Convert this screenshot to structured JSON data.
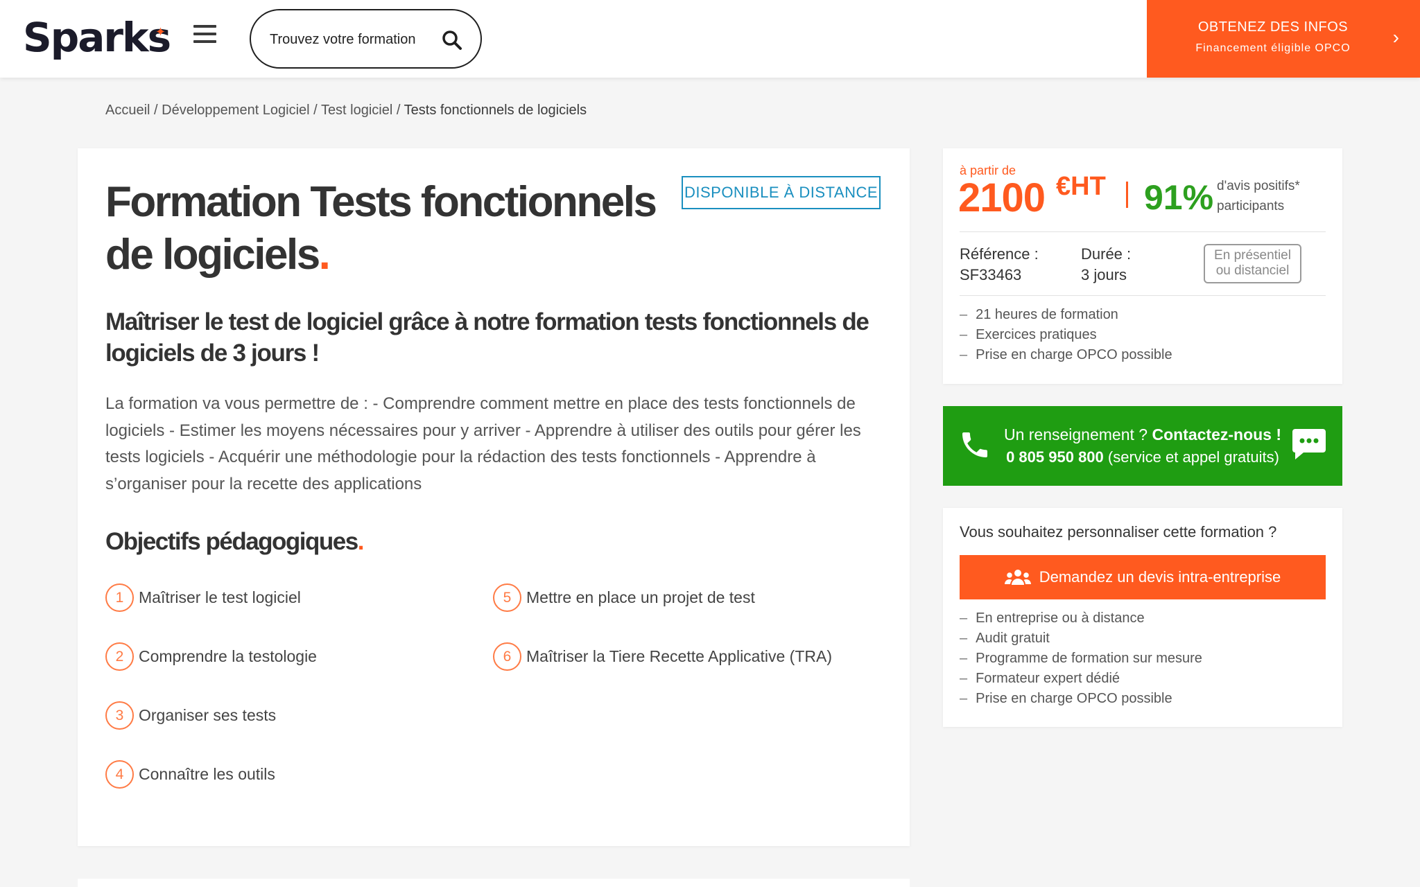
{
  "header": {
    "logo": "Sparks",
    "search_placeholder": "Trouvez votre formation",
    "cta_line1": "OBTENEZ DES INFOS",
    "cta_line2": "Financement éligible OPCO"
  },
  "breadcrumb": {
    "items": [
      "Accueil",
      "Développement Logiciel",
      "Test logiciel"
    ],
    "current": "Tests fonctionnels de logiciels",
    "separator": " / "
  },
  "main": {
    "badge": "DISPONIBLE À DISTANCE",
    "title_line1": "Formation Tests fonctionnels",
    "title_line2": "de logiciels",
    "subtitle": "Maîtriser le test de logiciel grâce à notre formation tests fonctionnels de logiciels de 3 jours !",
    "intro": "La formation va vous permettre de : - Comprendre comment mettre en place des tests fonctionnels de logiciels - Estimer les moyens nécessaires pour y arriver - Apprendre à utiliser des outils pour gérer les tests logiciels - Acquérir une méthodologie pour la rédaction des tests fonctionnels - Apprendre à s’organiser pour la recette des applications",
    "objectives_title": "Objectifs pédagogiques",
    "objectives": [
      {
        "num": "1",
        "label": "Maîtriser le test logiciel"
      },
      {
        "num": "2",
        "label": "Comprendre la testologie"
      },
      {
        "num": "3",
        "label": "Organiser ses tests"
      },
      {
        "num": "4",
        "label": "Connaître les outils"
      },
      {
        "num": "5",
        "label": "Mettre en place un projet de test"
      },
      {
        "num": "6",
        "label": "Maîtriser la Tiere Recette Applicative (TRA)"
      }
    ]
  },
  "price_card": {
    "from_label": "à partir de",
    "price": "2100",
    "currency": "€HT",
    "percent": "91%",
    "avis_line1": "d'avis positifs*",
    "avis_line2": "participants",
    "reference_label": "Référence :",
    "reference_value": "SF33463",
    "duration_label": "Durée :",
    "duration_value": "3 jours",
    "mode_line1": "En présentiel",
    "mode_line2": "ou distanciel",
    "features": [
      "21 heures de formation",
      "Exercices pratiques",
      "Prise en charge OPCO possible"
    ]
  },
  "contact": {
    "text1": "Un renseignement ?",
    "text1_bold": "Contactez-nous !",
    "phone": "0 805 950 800",
    "phone_note": "(service et appel gratuits)"
  },
  "custom_card": {
    "question": "Vous souhaitez personnaliser cette formation ?",
    "button": "Demandez un devis intra-entreprise",
    "features": [
      "En entreprise ou à distance",
      "Audit gratuit",
      "Programme de formation sur mesure",
      "Formateur expert dédié",
      "Prise en charge OPCO possible"
    ]
  },
  "colors": {
    "accent": "#ff5a1f",
    "green": "#1f9d12",
    "badge_blue": "#1a8fbf"
  }
}
